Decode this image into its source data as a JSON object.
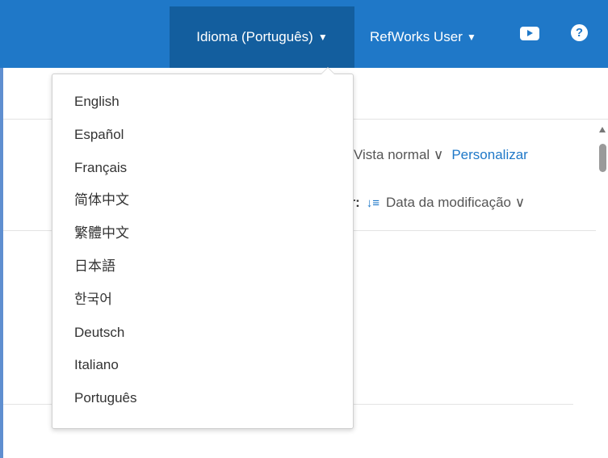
{
  "header": {
    "language_button": "Idioma (Português)",
    "language_caret": "▼",
    "user_button": "RefWorks User",
    "user_caret": "▼",
    "help_glyph": "?"
  },
  "toolbar": {
    "view_select": "Vista normal ∨",
    "personalize": "Personalizar",
    "sort_label": "ar:",
    "sort_icon": "↓≡",
    "sort_select": "Data da modificação ∨"
  },
  "language_menu": {
    "items": [
      "English",
      "Español",
      "Français",
      "简体中文",
      "繁體中文",
      "日本語",
      "한국어",
      "Deutsch",
      "Italiano",
      "Português"
    ]
  },
  "colors": {
    "header_bg": "#1f78c8",
    "active_button_bg": "#135e9e",
    "link": "#1f78c8"
  },
  "icons": [
    "chevron-down-icon",
    "youtube-icon",
    "help-icon",
    "sort-icon",
    "scroll-up-arrow"
  ]
}
